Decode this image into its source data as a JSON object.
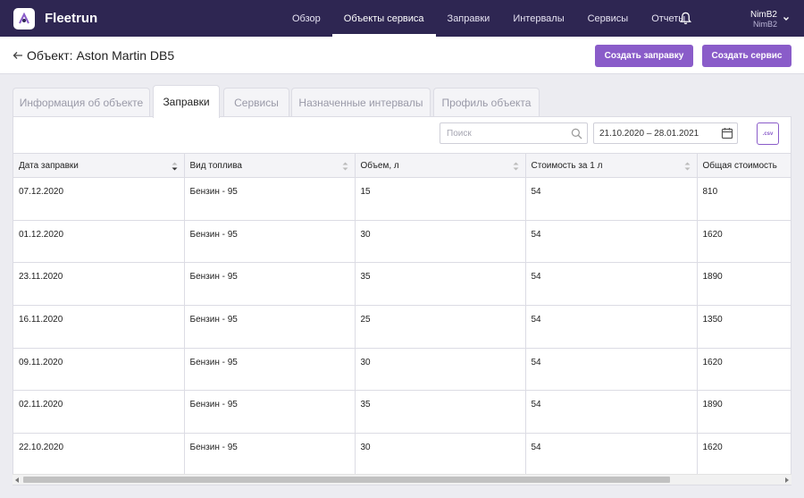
{
  "app": {
    "brand": "Fleetrun"
  },
  "nav": {
    "items": [
      {
        "label": "Обзор"
      },
      {
        "label": "Объекты сервиса"
      },
      {
        "label": "Заправки"
      },
      {
        "label": "Интервалы"
      },
      {
        "label": "Сервисы"
      },
      {
        "label": "Отчеты"
      }
    ],
    "active_index": 1
  },
  "user": {
    "name": "NimB2",
    "account": "NimB2"
  },
  "header": {
    "title": "Объект: Aston Martin DB5",
    "create_refuel_label": "Создать заправку",
    "create_service_label": "Создать сервис"
  },
  "tabs": [
    {
      "label": "Информация об объекте"
    },
    {
      "label": "Заправки"
    },
    {
      "label": "Сервисы"
    },
    {
      "label": "Назначенные интервалы"
    },
    {
      "label": "Профиль объекта"
    }
  ],
  "toolbar": {
    "search_placeholder": "Поиск",
    "date_range": "21.10.2020 – 28.01.2021",
    "csv_label": ".csv"
  },
  "table": {
    "columns": [
      "Дата заправки",
      "Вид топлива",
      "Объем, л",
      "Стоимость за 1 л",
      "Общая стоимость"
    ],
    "rows": [
      [
        "07.12.2020",
        "Бензин - 95",
        "15",
        "54",
        "810"
      ],
      [
        "01.12.2020",
        "Бензин - 95",
        "30",
        "54",
        "1620"
      ],
      [
        "23.11.2020",
        "Бензин - 95",
        "35",
        "54",
        "1890"
      ],
      [
        "16.11.2020",
        "Бензин - 95",
        "25",
        "54",
        "1350"
      ],
      [
        "09.11.2020",
        "Бензин - 95",
        "30",
        "54",
        "1620"
      ],
      [
        "02.11.2020",
        "Бензин - 95",
        "35",
        "54",
        "1890"
      ],
      [
        "22.10.2020",
        "Бензин - 95",
        "30",
        "54",
        "1620"
      ]
    ]
  },
  "colors": {
    "nav_bg": "#2e2652",
    "accent": "#8a5cc9"
  }
}
